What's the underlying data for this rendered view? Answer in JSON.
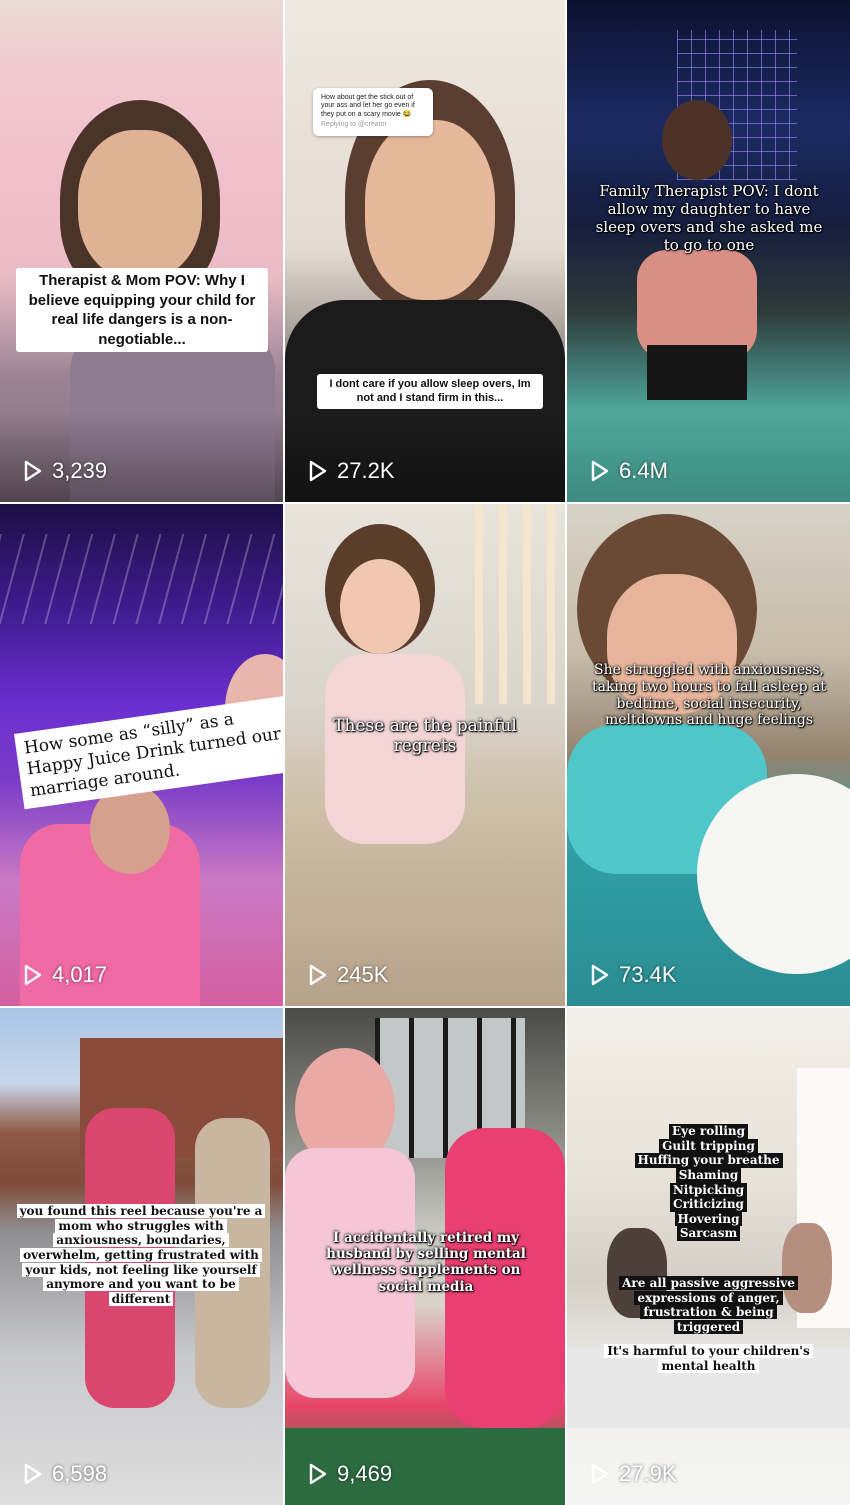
{
  "reels": [
    {
      "views": "3,239",
      "caption": "Therapist & Mom POV: Why I believe equipping your child for real life dangers is a non-negotiable..."
    },
    {
      "views": "27.2K",
      "caption": "I dont care if you allow sleep overs, Im not and I stand firm in this...",
      "comment": "How about get the stick out of your ass and let her go even if they put on a scary movie 😂",
      "comment_meta": "Replying to @creator"
    },
    {
      "views": "6.4M",
      "caption": "Family Therapist POV: I dont allow my daughter to have sleep overs and she asked me to go to one"
    },
    {
      "views": "4,017",
      "caption": "How some as “silly” as a Happy Juice Drink turned our marriage around."
    },
    {
      "views": "245K",
      "caption": "These are the painful regrets"
    },
    {
      "views": "73.4K",
      "caption": "She struggled with anxiousness, taking two hours to fall asleep at bedtime, social insecurity, meltdowns and huge feelings"
    },
    {
      "views": "6,598",
      "caption": "you found this reel because you're a mom who struggles with anxiousness, boundaries, overwhelm, getting frustrated with your kids, not feeling like yourself anymore and you want to be different"
    },
    {
      "views": "9,469",
      "caption": "I accidentally retired my husband by selling mental wellness supplements on social media"
    },
    {
      "views": "27.9K",
      "caption_lines": [
        "Eye rolling",
        "Guilt tripping",
        "Huffing your breathe",
        "Shaming",
        "Nitpicking",
        "Criticizing",
        "Hovering",
        "Sarcasm"
      ],
      "caption2": "Are all passive aggressive expressions of anger, frustration & being triggered",
      "caption3": "It's harmful to your children's mental health"
    }
  ]
}
